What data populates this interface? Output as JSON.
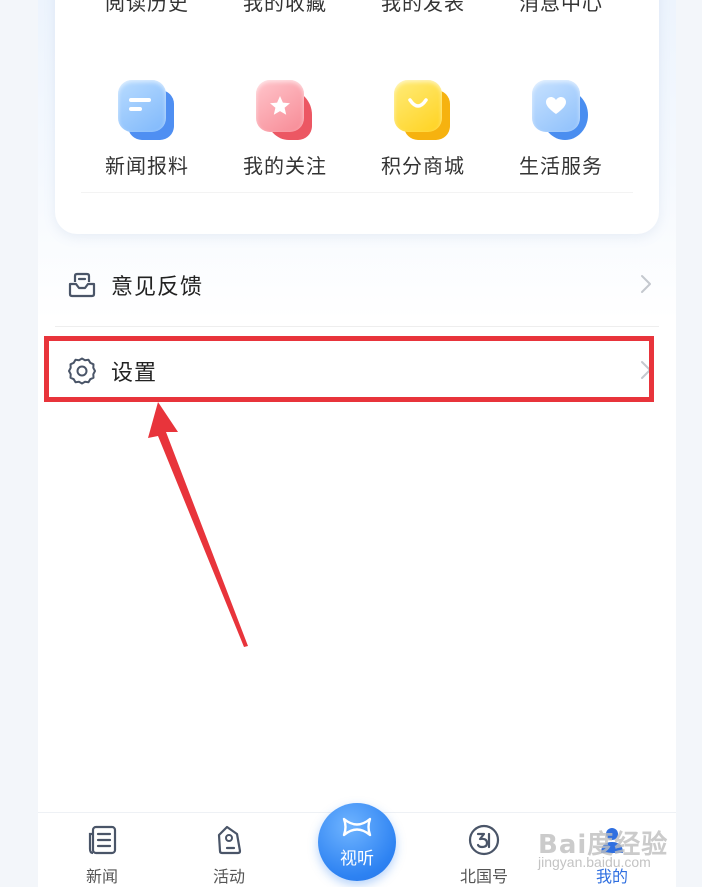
{
  "grid": {
    "top_row": [
      {
        "label": "阅读历史"
      },
      {
        "label": "我的收藏"
      },
      {
        "label": "我的发表"
      },
      {
        "label": "消息中心"
      }
    ],
    "mid_row": [
      {
        "label": "新闻报料",
        "icon": "news-report-icon",
        "color": "#4f8ff2"
      },
      {
        "label": "我的关注",
        "icon": "star-follow-icon",
        "color": "#ec5763"
      },
      {
        "label": "积分商城",
        "icon": "shopping-bag-icon",
        "color": "#f6b20f"
      },
      {
        "label": "生活服务",
        "icon": "heart-service-icon",
        "color": "#4a8ef0"
      }
    ]
  },
  "list": {
    "feedback": {
      "label": "意见反馈",
      "icon": "feedback-envelope-icon"
    },
    "settings": {
      "label": "设置",
      "icon": "gear-icon"
    }
  },
  "annotation": {
    "highlight_color": "#e8343b"
  },
  "bottom_nav": {
    "items": [
      {
        "label": "新闻",
        "icon": "newspaper-icon"
      },
      {
        "label": "活动",
        "icon": "tag-location-icon"
      },
      {
        "label": "视听",
        "icon": "play-bowtie-icon"
      },
      {
        "label": "北国号",
        "icon": "badge-icon"
      },
      {
        "label": "我的",
        "icon": "person-icon"
      }
    ],
    "active_color": "#2f6fe0",
    "center_color": "#2d82f2"
  },
  "watermark": {
    "main": "Bai度经验",
    "sub": "jingyan.baidu.com"
  }
}
